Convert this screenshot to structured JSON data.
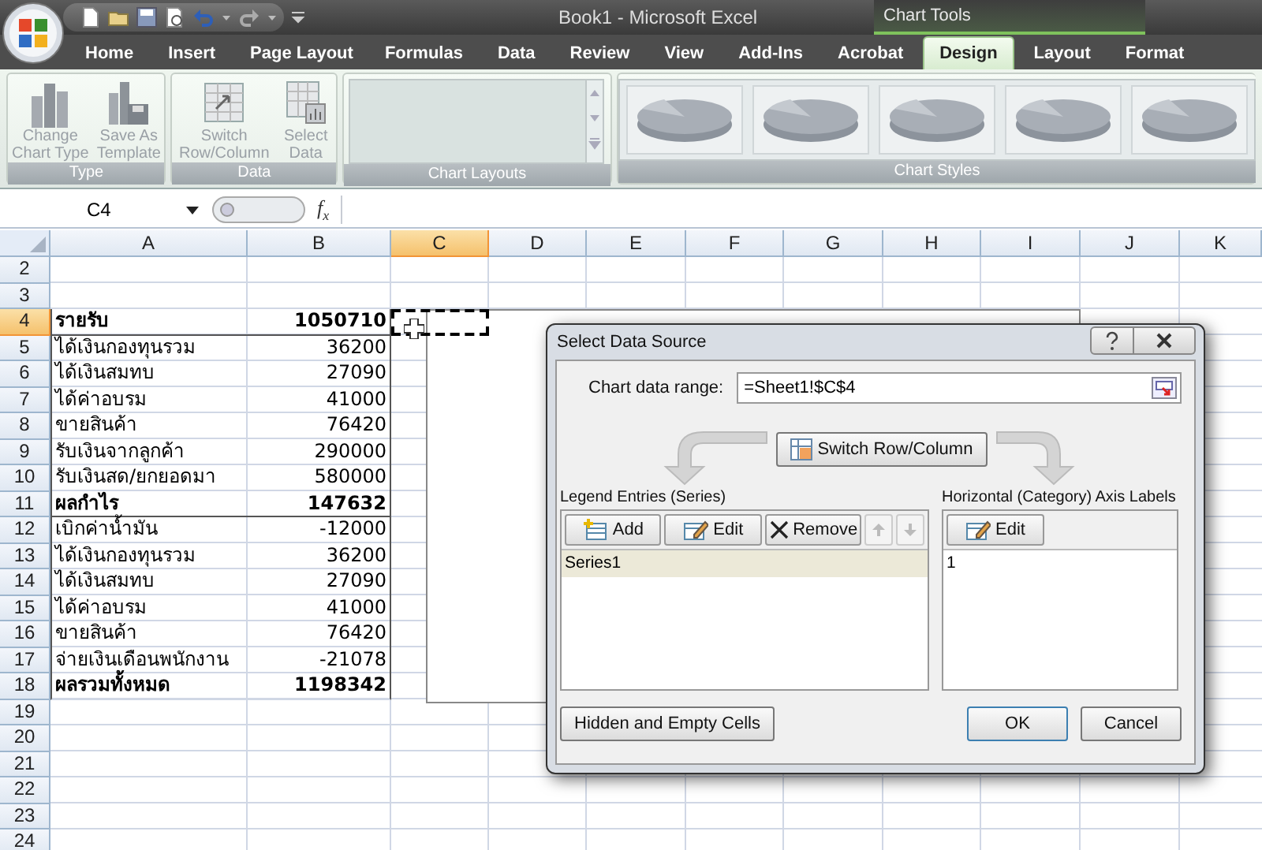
{
  "title_bar": {
    "title": "Book1 - Microsoft Excel",
    "context_label": "Chart Tools"
  },
  "tabs": [
    {
      "label": "Home",
      "selected": false
    },
    {
      "label": "Insert",
      "selected": false
    },
    {
      "label": "Page Layout",
      "selected": false
    },
    {
      "label": "Formulas",
      "selected": false
    },
    {
      "label": "Data",
      "selected": false
    },
    {
      "label": "Review",
      "selected": false
    },
    {
      "label": "View",
      "selected": false
    },
    {
      "label": "Add-Ins",
      "selected": false
    },
    {
      "label": "Acrobat",
      "selected": false
    },
    {
      "label": "Design",
      "selected": true
    },
    {
      "label": "Layout",
      "selected": false
    },
    {
      "label": "Format",
      "selected": false
    }
  ],
  "ribbon": {
    "groups": [
      {
        "kind": "buttons",
        "label": "Type",
        "buttons": [
          {
            "kind": "chart-type",
            "lines": [
              "Change",
              "Chart Type"
            ],
            "disabled": true
          },
          {
            "kind": "save-template",
            "lines": [
              "Save As",
              "Template"
            ],
            "disabled": true
          }
        ]
      },
      {
        "kind": "buttons",
        "label": "Data",
        "buttons": [
          {
            "kind": "switch",
            "lines": [
              "Switch",
              "Row/Column"
            ],
            "disabled": true
          },
          {
            "kind": "select",
            "lines": [
              "Select",
              "Data"
            ],
            "disabled": true
          }
        ]
      },
      {
        "kind": "gallery",
        "label": "Chart Layouts"
      },
      {
        "kind": "gallery",
        "label": "Chart Styles",
        "items": [
          {
            "kind": "pie"
          },
          {
            "kind": "pie"
          },
          {
            "kind": "pie"
          },
          {
            "kind": "pie"
          },
          {
            "kind": "pie"
          }
        ]
      }
    ]
  },
  "formula_bar": {
    "name_box": "C4",
    "function_label": "f$_{x}$"
  },
  "sheet": {
    "columns": [
      {
        "label": "A",
        "selected": false
      },
      {
        "label": "B",
        "selected": false
      },
      {
        "label": "C",
        "selected": true
      },
      {
        "label": "D",
        "selected": false
      },
      {
        "label": "E",
        "selected": false
      },
      {
        "label": "F",
        "selected": false
      },
      {
        "label": "G",
        "selected": false
      },
      {
        "label": "H",
        "selected": false
      },
      {
        "label": "I",
        "selected": false
      },
      {
        "label": "J",
        "selected": false
      },
      {
        "label": "K",
        "selected": false
      }
    ],
    "rows": [
      {
        "number": "2",
        "selected": false
      },
      {
        "number": "3",
        "selected": false
      },
      {
        "number": "4",
        "selected": true,
        "kind": "header",
        "cells": [
          "รายรับ",
          "1050710"
        ]
      },
      {
        "number": "5",
        "selected": false,
        "kind": "item",
        "cells": [
          "ได้เงินกองทุนรวม",
          "36200"
        ]
      },
      {
        "number": "6",
        "selected": false,
        "kind": "item",
        "cells": [
          "ได้เงินสมทบ",
          "27090"
        ]
      },
      {
        "number": "7",
        "selected": false,
        "kind": "item",
        "cells": [
          "ได้ค่าอบรม",
          "41000"
        ]
      },
      {
        "number": "8",
        "selected": false,
        "kind": "item",
        "cells": [
          "ขายสินค้า",
          "76420"
        ]
      },
      {
        "number": "9",
        "selected": false,
        "kind": "item",
        "cells": [
          "รับเงินจากลูกค้า",
          "290000"
        ]
      },
      {
        "number": "10",
        "selected": false,
        "kind": "item",
        "cells": [
          "รับเงินสด/ยกยอดมา",
          "580000"
        ]
      },
      {
        "number": "11",
        "selected": false,
        "kind": "header",
        "cells": [
          "ผลกำไร",
          "147632"
        ]
      },
      {
        "number": "12",
        "selected": false,
        "kind": "item",
        "cells": [
          "เบิกค่าน้ำมัน",
          "-12000"
        ]
      },
      {
        "number": "13",
        "selected": false,
        "kind": "item",
        "cells": [
          "ได้เงินกองทุนรวม",
          "36200"
        ]
      },
      {
        "number": "14",
        "selected": false,
        "kind": "item",
        "cells": [
          "ได้เงินสมทบ",
          "27090"
        ]
      },
      {
        "number": "15",
        "selected": false,
        "kind": "item",
        "cells": [
          "ได้ค่าอบรม",
          "41000"
        ]
      },
      {
        "number": "16",
        "selected": false,
        "kind": "item",
        "cells": [
          "ขายสินค้า",
          "76420"
        ]
      },
      {
        "number": "17",
        "selected": false,
        "kind": "item",
        "cells": [
          "จ่ายเงินเดือนพนักงาน",
          "-21078"
        ]
      },
      {
        "number": "18",
        "selected": false,
        "kind": "total",
        "cells": [
          "ผลรวมทั้งหมด",
          "1198342"
        ]
      },
      {
        "number": "19",
        "selected": false
      },
      {
        "number": "20",
        "selected": false
      },
      {
        "number": "21",
        "selected": false
      },
      {
        "number": "22",
        "selected": false
      },
      {
        "number": "23",
        "selected": false
      },
      {
        "number": "24",
        "selected": false
      }
    ]
  },
  "dialog": {
    "title": "Select Data Source",
    "range_label": "Chart data range:",
    "range_value": "=Sheet1!$C$4",
    "switch_button": "Switch Row/Column",
    "legend": {
      "label": "Legend Entries (Series)",
      "buttons": [
        {
          "kind": "add",
          "label": "Add",
          "disabled": false
        },
        {
          "kind": "edit",
          "label": "Edit",
          "disabled": false
        },
        {
          "kind": "remove",
          "label": "Remove",
          "disabled": false
        },
        {
          "kind": "up",
          "disabled": true
        },
        {
          "kind": "down",
          "disabled": true
        }
      ],
      "items": [
        {
          "label": "Series1",
          "selected": true
        }
      ]
    },
    "axis": {
      "label": "Horizontal (Category) Axis Labels",
      "buttons": [
        {
          "kind": "edit",
          "label": "Edit",
          "disabled": false
        }
      ],
      "items": [
        {
          "label": "1",
          "selected": false
        }
      ]
    },
    "buttons": [
      {
        "kind": "hidden-cells",
        "label": "Hidden and Empty Cells"
      },
      {
        "kind": "ok",
        "label": "OK"
      },
      {
        "kind": "cancel",
        "label": "Cancel"
      }
    ]
  }
}
